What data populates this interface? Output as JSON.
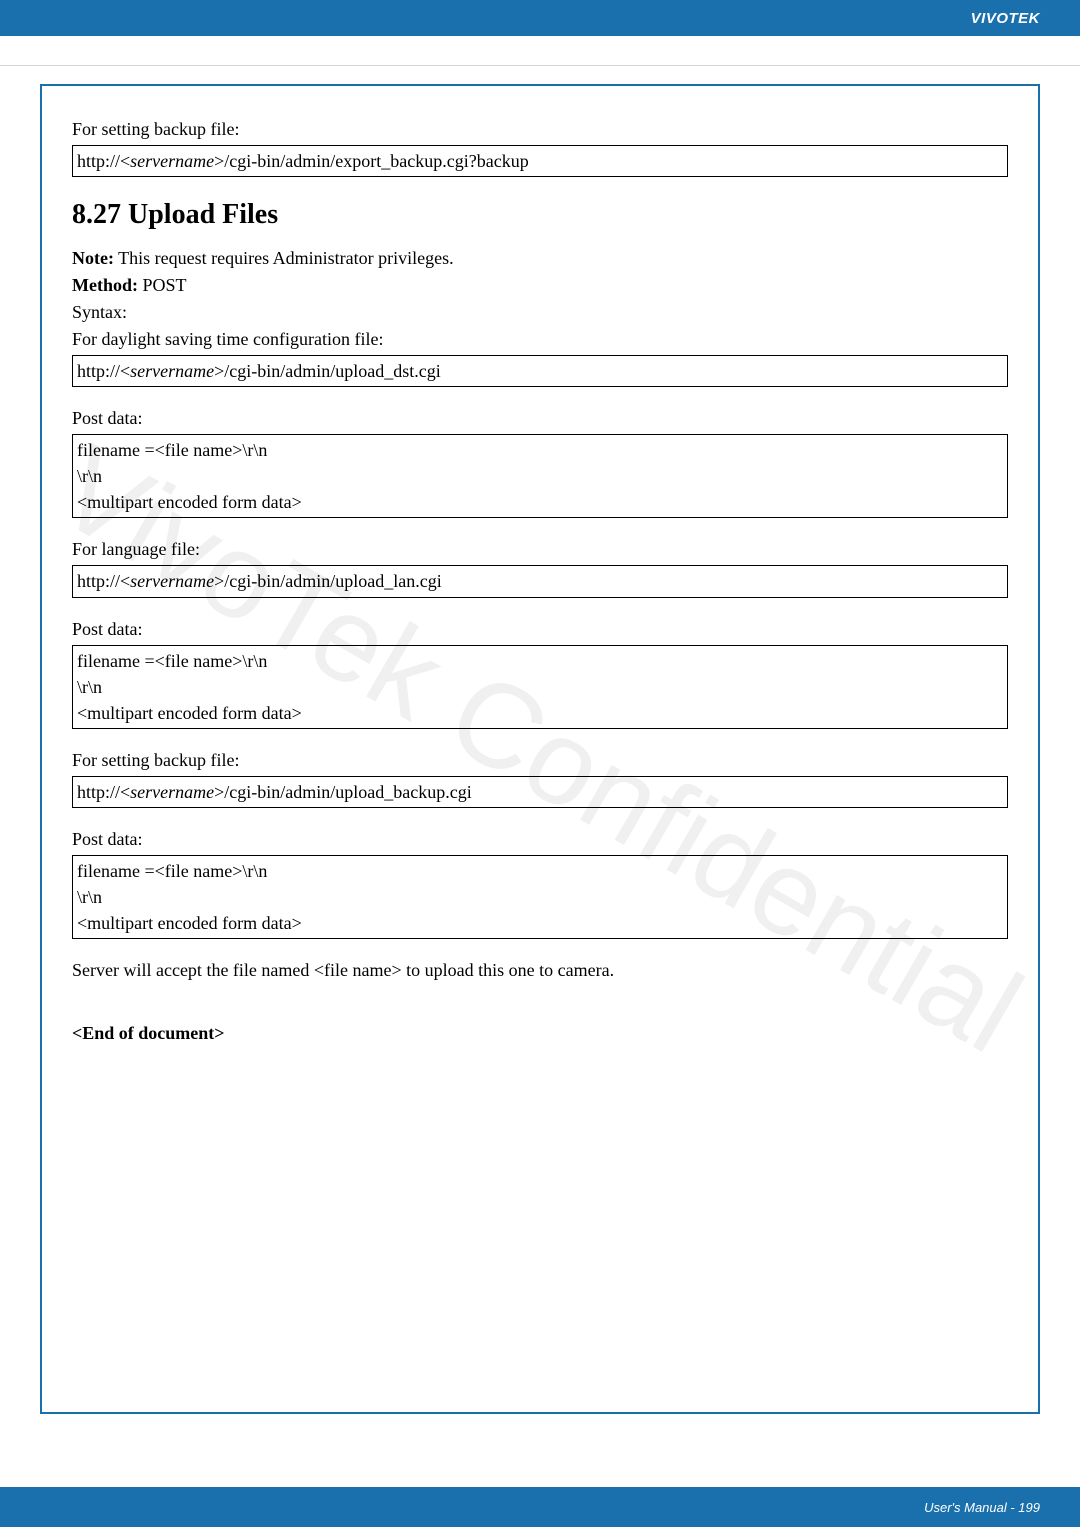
{
  "header": {
    "brand": "VIVOTEK"
  },
  "watermark": "VivoTek Confidential",
  "s1": {
    "label": "For setting backup file:",
    "url_pre": "http://<",
    "url_srv": "servername",
    "url_post": ">/cgi-bin/admin/export_backup.cgi?backup"
  },
  "section": {
    "title": "8.27 Upload Files"
  },
  "note": {
    "bold": "Note:",
    "text": " This request requires Administrator privileges.",
    "method_b": "Method:",
    "method_v": " POST"
  },
  "syntax": {
    "label": "Syntax:",
    "dst_label": "For daylight saving time configuration file:",
    "dst_url_pre": "http://<",
    "dst_url_srv": "servername",
    "dst_url_post": ">/cgi-bin/admin/upload_dst.cgi"
  },
  "post1": {
    "label": "Post data:",
    "line1": "filename =<file name>\\r\\n",
    "line2": "\\r\\n",
    "line3": "<multipart encoded form data>"
  },
  "lang": {
    "label": "For language file:",
    "url_pre": "http://<",
    "url_srv": "servername",
    "url_post": ">/cgi-bin/admin/upload_lan.cgi"
  },
  "post2": {
    "label": "Post data:",
    "line1": "filename =<file name>\\r\\n",
    "line2": "\\r\\n",
    "line3": "<multipart encoded form data>"
  },
  "backup": {
    "label": "For setting backup file:",
    "url_pre": "http://<",
    "url_srv": "servername",
    "url_post": ">/cgi-bin/admin/upload_backup.cgi"
  },
  "post3": {
    "label": "Post data:",
    "line1": "filename =<file name>\\r\\n",
    "line2": "\\r\\n",
    "line3": "<multipart encoded form data>"
  },
  "server_note": "Server will accept the file named <file name> to upload this one to camera.",
  "end": "<End of document>",
  "footer": {
    "text": "User's Manual - 199"
  }
}
